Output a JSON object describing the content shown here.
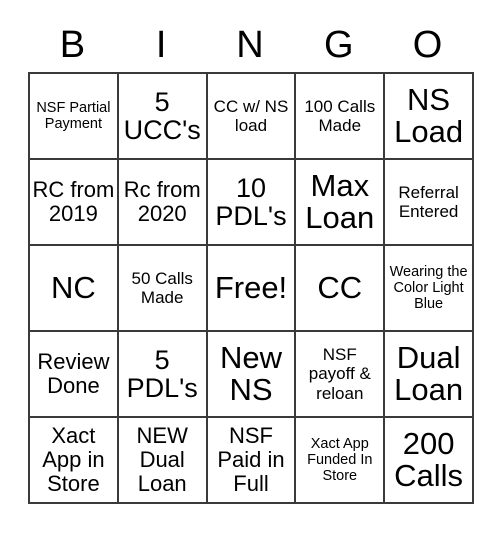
{
  "card": {
    "title": "BINGO Card",
    "headers": [
      "B",
      "I",
      "N",
      "G",
      "O"
    ],
    "rows": [
      [
        {
          "text": "NSF Partial Payment",
          "size": "xs"
        },
        {
          "text": "5 UCC's",
          "size": "l"
        },
        {
          "text": "CC w/ NS load",
          "size": "s"
        },
        {
          "text": "100 Calls Made",
          "size": "s"
        },
        {
          "text": "NS Load",
          "size": "xl"
        }
      ],
      [
        {
          "text": "RC from 2019",
          "size": "m"
        },
        {
          "text": "Rc from 2020",
          "size": "m"
        },
        {
          "text": "10 PDL's",
          "size": "l"
        },
        {
          "text": "Max Loan",
          "size": "xl"
        },
        {
          "text": "Referral Entered",
          "size": "s"
        }
      ],
      [
        {
          "text": "NC",
          "size": "xl"
        },
        {
          "text": "50 Calls Made",
          "size": "s"
        },
        {
          "text": "Free!",
          "size": "xl"
        },
        {
          "text": "CC",
          "size": "xl"
        },
        {
          "text": "Wearing the Color Light Blue",
          "size": "xs"
        }
      ],
      [
        {
          "text": "Review Done",
          "size": "m"
        },
        {
          "text": "5 PDL's",
          "size": "l"
        },
        {
          "text": "New NS",
          "size": "xl"
        },
        {
          "text": "NSF payoff & reloan",
          "size": "s"
        },
        {
          "text": "Dual Loan",
          "size": "xl"
        }
      ],
      [
        {
          "text": "Xact App in Store",
          "size": "m"
        },
        {
          "text": "NEW Dual Loan",
          "size": "m"
        },
        {
          "text": "NSF Paid in Full",
          "size": "m"
        },
        {
          "text": "Xact App Funded In Store",
          "size": "xs"
        },
        {
          "text": "200 Calls",
          "size": "xl"
        }
      ]
    ],
    "colors": {
      "background": "#ffffff",
      "text": "#000000",
      "border": "#3a3a3a"
    }
  }
}
